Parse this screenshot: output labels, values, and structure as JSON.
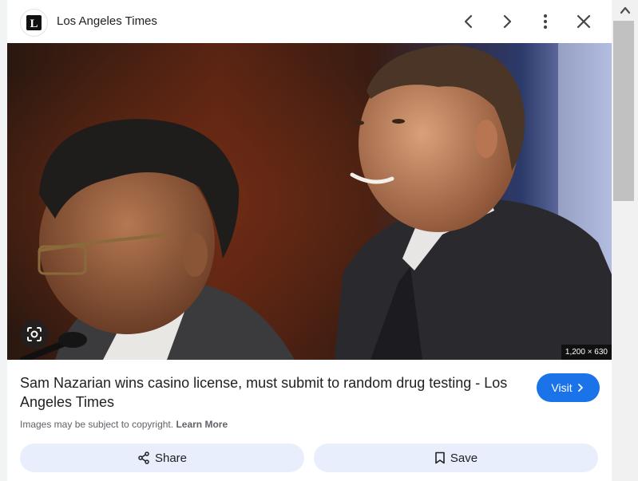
{
  "header": {
    "site_name": "Los Angeles Times",
    "logo_letter": "L",
    "icons": [
      "chevron-left-icon",
      "chevron-right-icon",
      "more-vert-icon",
      "close-icon"
    ]
  },
  "image": {
    "dimensions": "1,200 × 630",
    "lens_icon": "lens-icon"
  },
  "result": {
    "title": "Sam Nazarian wins casino license, must submit to random drug testing - Los Angeles Times",
    "visit_label": "Visit",
    "copyright_text": "Images may be subject to copyright.",
    "learn_more": "Learn More"
  },
  "actions": {
    "share_label": "Share",
    "save_label": "Save"
  },
  "colors": {
    "accent": "#1a73e8",
    "action_bg": "#e8eefb",
    "text": "#202124",
    "muted": "#5f6368"
  }
}
